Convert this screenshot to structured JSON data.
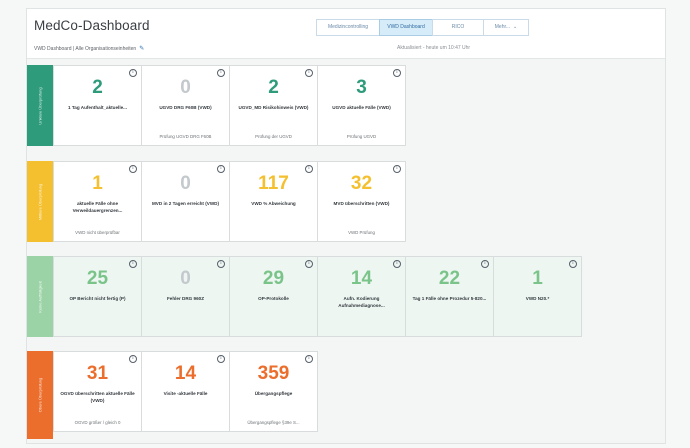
{
  "app_title": "MedCo-Dashboard",
  "nav": [
    {
      "label": "Medizincontrolling",
      "active": false
    },
    {
      "label": "VWD Dashboard",
      "active": true
    },
    {
      "label": "RICO",
      "active": false
    },
    {
      "label": "Mehr...",
      "active": false
    }
  ],
  "breadcrumb": "VWD Dashboard | Alle Organisationseinheiten",
  "updated": "Aktualisiert - heute um 10:47 Uhr",
  "colors": {
    "teal": "#2e9b7b",
    "yellow": "#f4c02f",
    "green": "#9bd3a7",
    "orange": "#ec6e2d",
    "grey": "#c4c9cd"
  },
  "rows": [
    {
      "label": "Unklare Überprüfung",
      "tiles": [
        {
          "value": "2",
          "desc": "1 Tag Aufenthalt_aktuelle...",
          "sub": "",
          "color": "#2e9b7b"
        },
        {
          "value": "0",
          "desc": "UGVD DRG F60B (VWD)",
          "sub": "Prüfung UGVD DRG F60B",
          "color": "#c4c9cd"
        },
        {
          "value": "2",
          "desc": "UGVD_MD Risikohinweis (VWD)",
          "sub": "Prüfung der UGVD",
          "color": "#2e9b7b"
        },
        {
          "value": "3",
          "desc": "UGVD aktuelle Fälle (VWD)",
          "sub": "Prüfung UGVD",
          "color": "#2e9b7b"
        }
      ]
    },
    {
      "label": "Mittlere Überprüfung",
      "tiles": [
        {
          "value": "1",
          "desc": "aktuelle Fälle ohne Verweildauergrenzen...",
          "sub": "VWD nicht überprüfbar",
          "color": "#f4c02f"
        },
        {
          "value": "0",
          "desc": "MVD in 2 Tagen erreicht (VWD)",
          "sub": "",
          "color": "#c4c9cd"
        },
        {
          "value": "117",
          "desc": "VWD % Abweichung",
          "sub": "",
          "color": "#f4c02f"
        },
        {
          "value": "32",
          "desc": "MVD überschritten (VWD)",
          "sub": "VWD Prüfung",
          "color": "#f4c02f"
        }
      ]
    },
    {
      "label": "Keine Auffälligkeit",
      "tiles": [
        {
          "value": "25",
          "desc": "OP Bericht nicht fertig (P)",
          "sub": "",
          "color": "#7ac48a"
        },
        {
          "value": "0",
          "desc": "Fehler DRG 960Z",
          "sub": "",
          "color": "#c4c9cd"
        },
        {
          "value": "29",
          "desc": "OP-Protokolle",
          "sub": "",
          "color": "#7ac48a"
        },
        {
          "value": "14",
          "desc": "Aufn. Kodierung Aufnahmediagnose...",
          "sub": "",
          "color": "#7ac48a"
        },
        {
          "value": "22",
          "desc": "Tag 1 Fälle ohne Prozedur 5-820...",
          "sub": "",
          "color": "#7ac48a"
        },
        {
          "value": "1",
          "desc": "VWD N20.*",
          "sub": "",
          "color": "#7ac48a"
        }
      ]
    },
    {
      "label": "Obere Überprüfung",
      "tiles": [
        {
          "value": "31",
          "desc": "OGVD überschritten aktuelle Fälle (VWD)",
          "sub": "OGVD größer / gleich 0",
          "color": "#ec6e2d"
        },
        {
          "value": "14",
          "desc": "Visite -aktuelle Fälle",
          "sub": "",
          "color": "#ec6e2d"
        },
        {
          "value": "359",
          "desc": "Übergangspflege",
          "sub": "Übergangspflege §39e S...",
          "color": "#ec6e2d"
        }
      ]
    }
  ]
}
